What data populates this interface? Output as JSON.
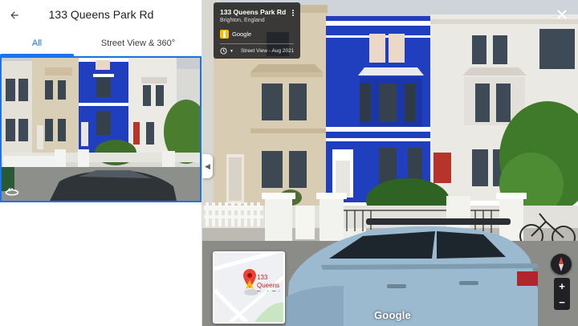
{
  "panel": {
    "title": "133 Queens Park Rd",
    "tabs": [
      {
        "label": "All",
        "active": true
      },
      {
        "label": "Street View & 360°",
        "active": false
      }
    ]
  },
  "street_view": {
    "info_card": {
      "address": "133 Queens Park Rd",
      "locality": "Brighton, England",
      "provider": "Google",
      "date_label": "Street View - Aug 2021"
    },
    "minimap": {
      "label": "133 Queens Park Rd Brighton"
    },
    "watermark": "Google"
  },
  "icons": {
    "back": "arrow-left-icon",
    "photo_360": "360-icon",
    "collapse": "chevron-left-icon",
    "more": "more-vert-icon",
    "history": "clock-icon",
    "close": "close-icon",
    "compass": "compass-icon",
    "zoom_in": "plus-icon",
    "zoom_out": "minus-icon"
  },
  "colors": {
    "accent": "#1a73e8",
    "house_blue": "#1f3fbf",
    "card_bg": "#202124"
  }
}
